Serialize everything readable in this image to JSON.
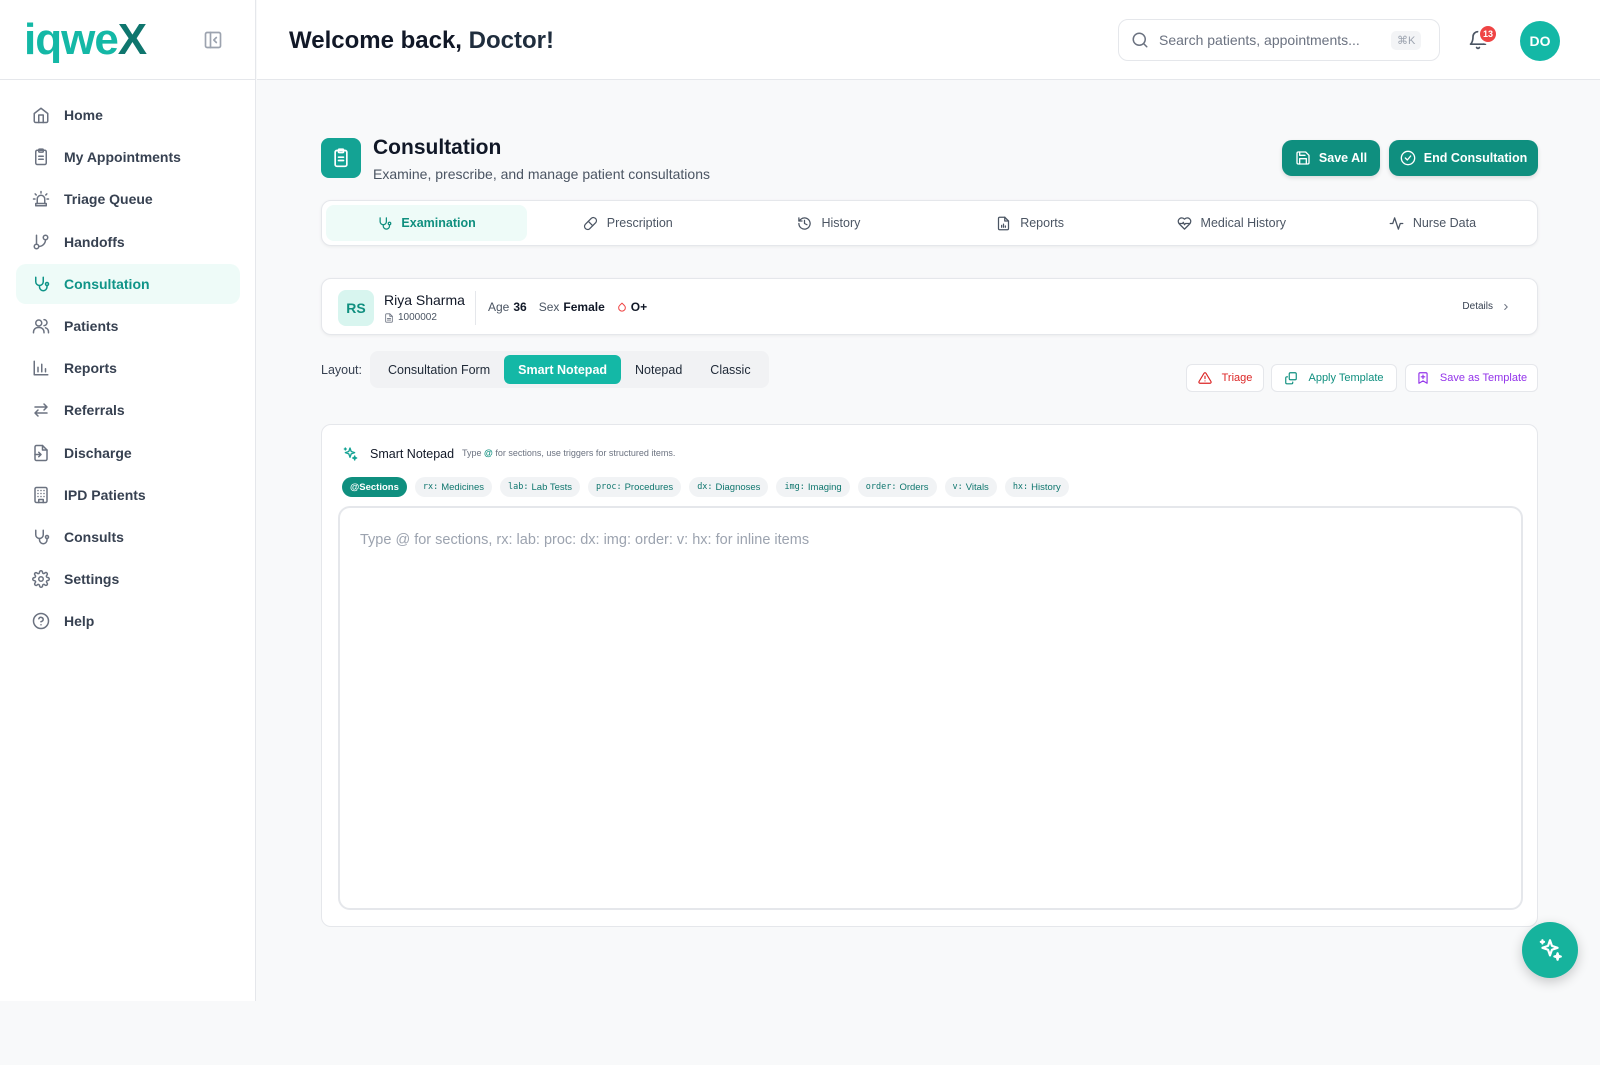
{
  "brand": {
    "logo_part1": "iqwe",
    "logo_part2": "X"
  },
  "sidebar": {
    "items": [
      {
        "label": "Home",
        "icon": "home-icon",
        "active": false
      },
      {
        "label": "My Appointments",
        "icon": "clipboard-icon",
        "active": false
      },
      {
        "label": "Triage Queue",
        "icon": "siren-icon",
        "active": false
      },
      {
        "label": "Handoffs",
        "icon": "git-branch-icon",
        "active": false
      },
      {
        "label": "Consultation",
        "icon": "stethoscope-icon",
        "active": true
      },
      {
        "label": "Patients",
        "icon": "users-icon",
        "active": false
      },
      {
        "label": "Reports",
        "icon": "bar-chart-icon",
        "active": false
      },
      {
        "label": "Referrals",
        "icon": "arrows-icon",
        "active": false
      },
      {
        "label": "Discharge",
        "icon": "file-exit-icon",
        "active": false
      },
      {
        "label": "IPD Patients",
        "icon": "building-icon",
        "active": false
      },
      {
        "label": "Consults",
        "icon": "stethoscope-icon",
        "active": false
      },
      {
        "label": "Settings",
        "icon": "gear-icon",
        "active": false
      },
      {
        "label": "Help",
        "icon": "help-circle-icon",
        "active": false
      }
    ]
  },
  "header": {
    "welcome_prefix": "Welcome back, ",
    "welcome_name": "Doctor!",
    "search_placeholder": "Search patients, appointments...",
    "search_shortcut": "⌘K",
    "notification_count": "13",
    "avatar_initials": "DO"
  },
  "page": {
    "title": "Consultation",
    "subtitle": "Examine, prescribe, and manage patient consultations",
    "save_all_label": "Save All",
    "end_consultation_label": "End Consultation"
  },
  "tabs": [
    {
      "label": "Examination",
      "icon": "stethoscope-icon",
      "active": true
    },
    {
      "label": "Prescription",
      "icon": "pill-icon",
      "active": false
    },
    {
      "label": "History",
      "icon": "history-icon",
      "active": false
    },
    {
      "label": "Reports",
      "icon": "file-icon",
      "active": false
    },
    {
      "label": "Medical History",
      "icon": "heart-pulse-icon",
      "active": false
    },
    {
      "label": "Nurse Data",
      "icon": "activity-icon",
      "active": false
    }
  ],
  "patient": {
    "initials": "RS",
    "name": "Riya Sharma",
    "id": "1000002",
    "age_label": "Age",
    "age": "36",
    "sex_label": "Sex",
    "sex": "Female",
    "blood_group": "O+",
    "details_label": "Details"
  },
  "layout": {
    "label": "Layout:",
    "options": [
      {
        "label": "Consultation Form",
        "active": false
      },
      {
        "label": "Smart Notepad",
        "active": true
      },
      {
        "label": "Notepad",
        "active": false
      },
      {
        "label": "Classic",
        "active": false
      }
    ]
  },
  "tools": {
    "triage_label": "Triage",
    "apply_template_label": "Apply Template",
    "save_template_label": "Save as Template"
  },
  "notepad": {
    "title": "Smart Notepad",
    "hint_prefix": "Type",
    "hint_symbol": "@",
    "hint_suffix": "for sections, use triggers for structured items.",
    "chips": [
      {
        "trigger": "@",
        "label": "Sections",
        "active": true
      },
      {
        "trigger": "rx:",
        "label": "Medicines",
        "active": false
      },
      {
        "trigger": "lab:",
        "label": "Lab Tests",
        "active": false
      },
      {
        "trigger": "proc:",
        "label": "Procedures",
        "active": false
      },
      {
        "trigger": "dx:",
        "label": "Diagnoses",
        "active": false
      },
      {
        "trigger": "img:",
        "label": "Imaging",
        "active": false
      },
      {
        "trigger": "order:",
        "label": "Orders",
        "active": false
      },
      {
        "trigger": "v:",
        "label": "Vitals",
        "active": false
      },
      {
        "trigger": "hx:",
        "label": "History",
        "active": false
      }
    ],
    "editor_placeholder": "Type @ for sections, rx: lab: proc: dx: img: order: v: hx: for inline items"
  },
  "colors": {
    "primary": "#0f8f7f",
    "accent": "#14b8a6",
    "danger": "#dc2626",
    "purple": "#9333ea"
  }
}
